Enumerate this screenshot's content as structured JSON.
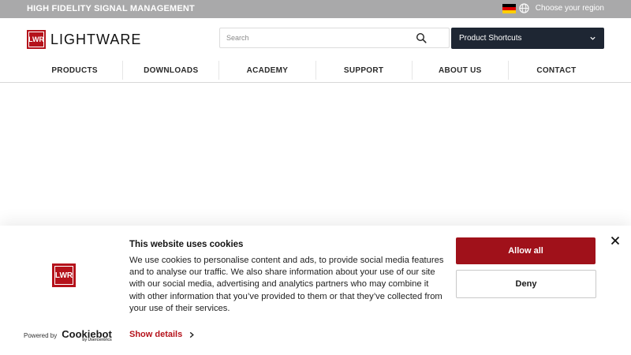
{
  "topbar": {
    "tagline": "HIGH FIDELITY SIGNAL MANAGEMENT",
    "region_label": "Choose your region",
    "flag_colors": [
      "#000000",
      "#dd0000",
      "#ffce00"
    ],
    "flag_icon": "germany-flag-icon",
    "globe_icon": "globe-icon"
  },
  "header": {
    "logo_mark": "LWR",
    "logo_text": "LIGHTWARE",
    "search": {
      "placeholder": "Search",
      "value": "",
      "icon": "search-icon"
    },
    "shortcuts": {
      "label": "Product Shortcuts",
      "icon": "chevron-down-icon"
    }
  },
  "nav": {
    "items": [
      "PRODUCTS",
      "DOWNLOADS",
      "ACADEMY",
      "SUPPORT",
      "ABOUT US",
      "CONTACT"
    ]
  },
  "cookie_banner": {
    "logo_mark": "LWR",
    "powered_by": "Powered by",
    "cookiebot_word": "Cookiebot",
    "cookiebot_sub": "by Usercentrics",
    "title": "This website uses cookies",
    "body": "We use cookies to personalise content and ads, to provide social media features and to analyse our traffic. We also share information about your use of our site with our social media, advertising and analytics partners who may combine it with other information that you’ve provided to them or that they’ve collected from your use of their services.",
    "show_details": "Show details",
    "allow_all": "Allow all",
    "deny": "Deny",
    "close_icon": "close-icon"
  },
  "colors": {
    "brand_red": "#b5121b",
    "allow_button": "#a0111a",
    "topbar_gray": "#a9a9aa",
    "shortcuts_navy": "#1e2633"
  }
}
